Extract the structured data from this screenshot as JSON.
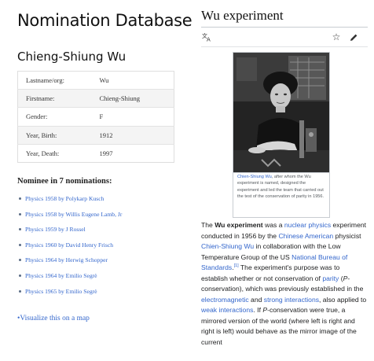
{
  "left": {
    "title": "Nomination Database",
    "person_name": "Chieng-Shiung Wu",
    "info_rows": [
      {
        "label": "Lastname/org:",
        "value": "Wu"
      },
      {
        "label": "Firstname:",
        "value": "Chieng-Shiung"
      },
      {
        "label": "Gender:",
        "value": "F"
      },
      {
        "label": "Year, Birth:",
        "value": "1912"
      },
      {
        "label": "Year, Death:",
        "value": "1997"
      }
    ],
    "nominations_heading": "Nominee in 7 nominations:",
    "nominations": [
      "Physics 1958 by Polykarp Kusch",
      "Physics 1958 by Willis Eugene Lamb, Jr",
      "Physics 1959 by J Rossel",
      "Physics 1960 by David Henry Frisch",
      "Physics 1964 by Herwig Schopper",
      "Physics 1964 by Emilio Segrè",
      "Physics 1965 by Emilio Segrè"
    ],
    "visualize_link": "Visualize this on a map"
  },
  "right": {
    "title": "Wu experiment",
    "icons": {
      "translate": "translate-icon",
      "star": "star-icon",
      "edit": "pencil-icon"
    },
    "caption": {
      "link": "Chien-Shiung Wu",
      "text": ", after whom the Wu experiment is named, designed the experiment and led the team that carried out the test of the conservation of parity in 1956."
    },
    "article": {
      "t01": "The ",
      "t02": "Wu experiment",
      "t03": " was a ",
      "t04": "nuclear physics",
      "t05": " experiment conducted in 1956 by the ",
      "t06": "Chinese American",
      "t07": " physicist ",
      "t08": "Chien-Shiung Wu",
      "t09": " in collaboration with the Low Temperature Group of the US ",
      "t10": "National Bureau of Standards",
      "t11": "[1]",
      "t12": " The experiment's purpose was to establish whether or not conservation of ",
      "t13": "parity",
      "t14": " (",
      "t15": "P",
      "t16": "-conservation), which was previously established in the ",
      "t17": "electromagnetic",
      "t18": " and ",
      "t19": "strong interactions",
      "t20": ", also applied to ",
      "t21": "weak interactions",
      "t22": ". If ",
      "t23": "P",
      "t24": "-conservation were true, a mirrored version of the world (where left is right and right is left) would behave as the mirror image of the current"
    }
  }
}
